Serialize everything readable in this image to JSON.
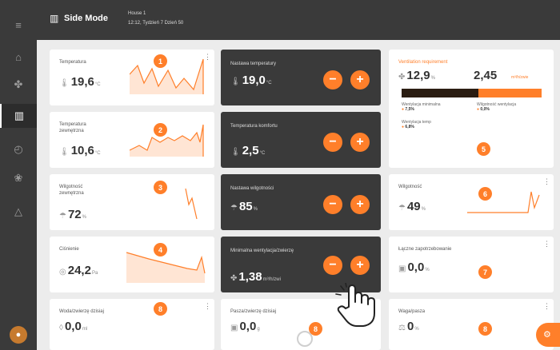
{
  "header": {
    "mode_title": "Side Mode",
    "house_name": "House 1",
    "house_subtitle": "12:12, Tydzień 7 Dzień 50"
  },
  "cards": {
    "temperature": {
      "label": "Temperatura",
      "value": "19,6",
      "unit": "°C"
    },
    "outdoor_temperature": {
      "label": "Temperatura zewnętrzna",
      "value": "10,6",
      "unit": "°C"
    },
    "outdoor_humidity": {
      "label": "Wilgotność zewnętrzna",
      "value": "72",
      "unit": "%"
    },
    "pressure": {
      "label": "Ciśnienie",
      "value": "24,2",
      "unit": "Pa"
    },
    "temperature_setpoint": {
      "label": "Nastawa temperatury",
      "value": "19,0",
      "unit": "°C"
    },
    "comfort_temperature": {
      "label": "Temperatura komfortu",
      "value": "2,5",
      "unit": "°C"
    },
    "humidity_setpoint": {
      "label": "Nastawa wilgotności",
      "value": "85",
      "unit": "%"
    },
    "min_ventilation": {
      "label": "Minimalna wentylacja/zwierzę",
      "value": "1,38",
      "unit": "m³/h/zwi"
    },
    "ventilation_requirement": {
      "label": "Ventilation requirement",
      "value": "12,9",
      "unit": "%",
      "value2": "2,45",
      "unit2": "m³/h/zwie",
      "progress_fraction": 0.55,
      "legend": [
        {
          "label": "Wentylacja minimalna",
          "value": "7,5%"
        },
        {
          "label": "Wilgotność wentylacja",
          "value": "0,0%"
        },
        {
          "label": "Wentylacja temp",
          "value": "6,8%"
        }
      ]
    },
    "humidity": {
      "label": "Wilgotność",
      "value": "49",
      "unit": "%"
    },
    "feed_consumption": {
      "label": "Łączne zapotrzebowanie",
      "value": "0,0",
      "unit": "%"
    },
    "water_per_animal": {
      "label": "Woda/zwierzę dzisiaj",
      "value": "0,0",
      "unit": "ml"
    },
    "feed_per_animal": {
      "label": "Pasza/zwierzę dzisiaj",
      "value": "0,0",
      "unit": "g"
    },
    "animal_weight": {
      "label": "Waga/pasza",
      "value": "0",
      "unit": "%"
    }
  },
  "badges": [
    "1",
    "2",
    "3",
    "4",
    "5",
    "6",
    "7",
    "8",
    "8",
    "8"
  ],
  "buttons": {
    "minus": "−",
    "plus": "+"
  },
  "icons": {
    "menu": "≡",
    "more": "⋮",
    "thermometer": "🌡",
    "humidity": "☂",
    "pressure": "◎",
    "fan": "✤",
    "water": "◊",
    "feed": "▣",
    "weight": "⚖"
  },
  "colors": {
    "accent": "#ff7f2a",
    "dark": "#3a3a3a",
    "background": "#ececec"
  }
}
